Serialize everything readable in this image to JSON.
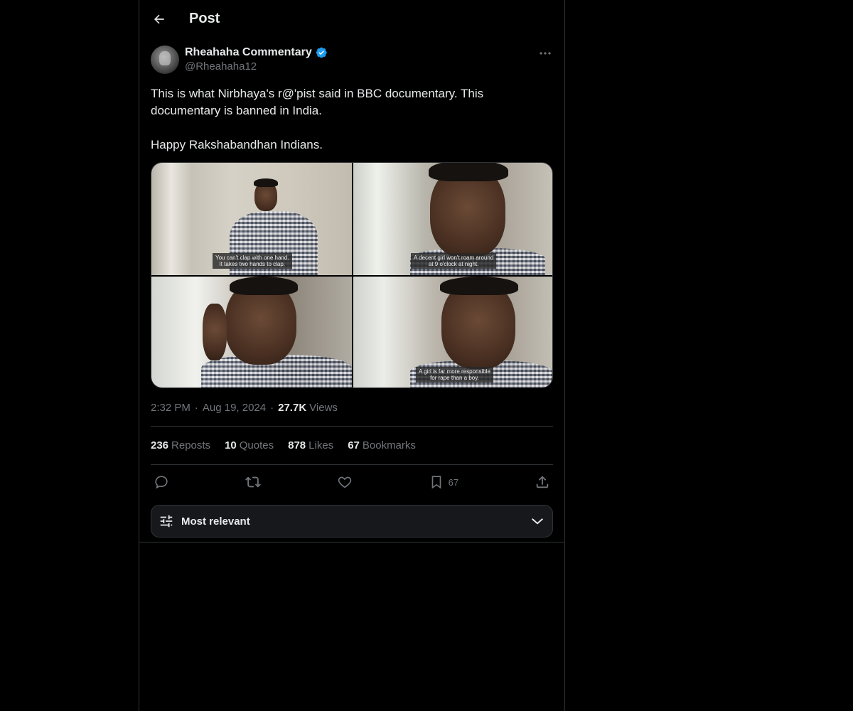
{
  "header": {
    "title": "Post"
  },
  "post": {
    "author": {
      "name": "Rheahaha Commentary",
      "handle": "@Rheahaha12",
      "verified": true
    },
    "text": "This is what Nirbhaya's r@'pist said in BBC documentary. This documentary is banned in India.\n\nHappy Rakshabandhan Indians.",
    "media": [
      {
        "caption": "You can't clap with one hand.\nIt takes two hands to clap."
      },
      {
        "caption": "A decent girl won't roam around\nat 9 o'clock at night."
      },
      {
        "caption": ""
      },
      {
        "caption": "A girl is far more responsible\nfor rape than a boy."
      }
    ],
    "time": "2:32 PM",
    "date": "Aug 19, 2024",
    "views_count": "27.7K",
    "views_label": "Views"
  },
  "stats": {
    "reposts": {
      "count": "236",
      "label": "Reposts"
    },
    "quotes": {
      "count": "10",
      "label": "Quotes"
    },
    "likes": {
      "count": "878",
      "label": "Likes"
    },
    "bookmarks": {
      "count": "67",
      "label": "Bookmarks"
    }
  },
  "actions": {
    "bookmark_count": "67"
  },
  "sort": {
    "label": "Most relevant"
  },
  "colors": {
    "background": "#000000",
    "text": "#e7e9ea",
    "muted": "#71767b",
    "border": "#2f3336",
    "verified": "#1d9bf0"
  },
  "icons": [
    "back-arrow-icon",
    "verified-badge-icon",
    "more-icon",
    "reply-icon",
    "repost-icon",
    "like-icon",
    "bookmark-icon",
    "share-icon",
    "sliders-icon",
    "chevron-down-icon"
  ]
}
